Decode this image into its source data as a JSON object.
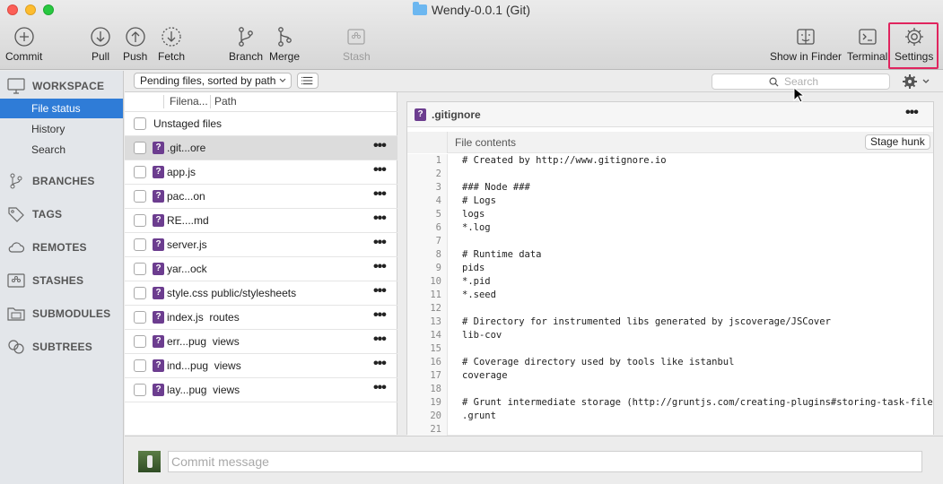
{
  "window": {
    "title": "Wendy-0.0.1 (Git)"
  },
  "toolbar": {
    "commit": "Commit",
    "pull": "Pull",
    "push": "Push",
    "fetch": "Fetch",
    "branch": "Branch",
    "merge": "Merge",
    "stash": "Stash",
    "show_in_finder": "Show in Finder",
    "terminal": "Terminal",
    "settings": "Settings"
  },
  "sidebar": {
    "workspace": "WORKSPACE",
    "items": [
      "File status",
      "History",
      "Search"
    ],
    "branches": "BRANCHES",
    "tags": "TAGS",
    "remotes": "REMOTES",
    "stashes": "STASHES",
    "submodules": "SUBMODULES",
    "subtrees": "SUBTREES"
  },
  "filelist": {
    "sort_label": "Pending files, sorted by path",
    "search_placeholder": "Search",
    "col_filename": "Filena...",
    "col_path": "Path",
    "unstaged_label": "Unstaged files",
    "files": [
      "gitignore_disp",
      "app.js"
    ],
    "rows": [
      {
        "name": ".git...ore",
        "path": ""
      },
      {
        "name": "app.js",
        "path": ""
      },
      {
        "name": "pac...on",
        "path": ""
      },
      {
        "name": "RE....md",
        "path": ""
      },
      {
        "name": "server.js",
        "path": ""
      },
      {
        "name": "yar...ock",
        "path": ""
      },
      {
        "name": "style.css",
        "path": "public/stylesheets"
      },
      {
        "name": "index.js",
        "path": "routes"
      },
      {
        "name": "err...pug",
        "path": "views"
      },
      {
        "name": "ind...pug",
        "path": "views"
      },
      {
        "name": "lay...pug",
        "path": "views"
      }
    ]
  },
  "diff": {
    "badge": "?",
    "filename": ".gitignore",
    "more": "•••",
    "hunk_title": "File contents",
    "stage_hunk": "Stage hunk",
    "lines": [
      {
        "n": "1",
        "t": "# Created by http://www.gitignore.io"
      },
      {
        "n": "2",
        "t": ""
      },
      {
        "n": "3",
        "t": "### Node ###"
      },
      {
        "n": "4",
        "t": "# Logs"
      },
      {
        "n": "5",
        "t": "logs"
      },
      {
        "n": "6",
        "t": "*.log"
      },
      {
        "n": "7",
        "t": ""
      },
      {
        "n": "8",
        "t": "# Runtime data"
      },
      {
        "n": "9",
        "t": "pids"
      },
      {
        "n": "10",
        "t": "*.pid"
      },
      {
        "n": "11",
        "t": "*.seed"
      },
      {
        "n": "12",
        "t": ""
      },
      {
        "n": "13",
        "t": "# Directory for instrumented libs generated by jscoverage/JSCover"
      },
      {
        "n": "14",
        "t": "lib-cov"
      },
      {
        "n": "15",
        "t": ""
      },
      {
        "n": "16",
        "t": "# Coverage directory used by tools like istanbul"
      },
      {
        "n": "17",
        "t": "coverage"
      },
      {
        "n": "18",
        "t": ""
      },
      {
        "n": "19",
        "t": "# Grunt intermediate storage (http://gruntjs.com/creating-plugins#storing-task-files)"
      },
      {
        "n": "20",
        "t": ".grunt"
      },
      {
        "n": "21",
        "t": ""
      }
    ]
  },
  "commit": {
    "placeholder": "Commit message"
  },
  "colors": {
    "accent": "#2f7cd7",
    "badge": "#6c3d8f",
    "highlight": "#e0245e"
  }
}
